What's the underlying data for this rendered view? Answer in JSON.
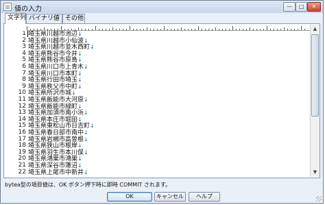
{
  "window": {
    "title": "値の入力",
    "minimize": "—",
    "maximize": "□",
    "close": "✕"
  },
  "tabs": [
    {
      "label": "文字列"
    },
    {
      "label": "バイナリ値"
    },
    {
      "label": "その他"
    }
  ],
  "editor": {
    "newline_mark": "↓",
    "lines": [
      {
        "n": "1",
        "text": "埼玉県川越市池辺"
      },
      {
        "n": "2",
        "text": "埼玉県川越市小仙波"
      },
      {
        "n": "3",
        "text": "埼玉県川越市並木西町"
      },
      {
        "n": "4",
        "text": "埼玉県熊谷市今井"
      },
      {
        "n": "5",
        "text": "埼玉県熊谷市原島"
      },
      {
        "n": "6",
        "text": "埼玉県川口市上青木"
      },
      {
        "n": "7",
        "text": "埼玉県川口市本町"
      },
      {
        "n": "8",
        "text": "埼玉県行田市埼玉"
      },
      {
        "n": "9",
        "text": "埼玉県秩父市中町"
      },
      {
        "n": "10",
        "text": "埼玉県所沢市城"
      },
      {
        "n": "11",
        "text": "埼玉県飯能市大河原"
      },
      {
        "n": "12",
        "text": "埼玉県飯能市緑町"
      },
      {
        "n": "13",
        "text": "埼玉県加須市南小浜"
      },
      {
        "n": "14",
        "text": "埼玉県本庄市堀田"
      },
      {
        "n": "15",
        "text": "埼玉県東松山市日吉町"
      },
      {
        "n": "16",
        "text": "埼玉県春日部市南中"
      },
      {
        "n": "17",
        "text": "埼玉県岩槻市高曽根"
      },
      {
        "n": "18",
        "text": "埼玉県狭山市根岸"
      },
      {
        "n": "19",
        "text": "埼玉県羽生市本川俣"
      },
      {
        "n": "20",
        "text": "埼玉県鴻巣市鴻巣"
      },
      {
        "n": "21",
        "text": "埼玉県深谷市蓮沼"
      },
      {
        "n": "22",
        "text": "埼玉県上尾市中新井"
      }
    ]
  },
  "status_text": "bytea型の項目値は、OK ボタン押下時に即時 COMMIT されます。",
  "buttons": {
    "ok": "OK",
    "cancel": "キャンセル",
    "help": "ヘルプ"
  }
}
